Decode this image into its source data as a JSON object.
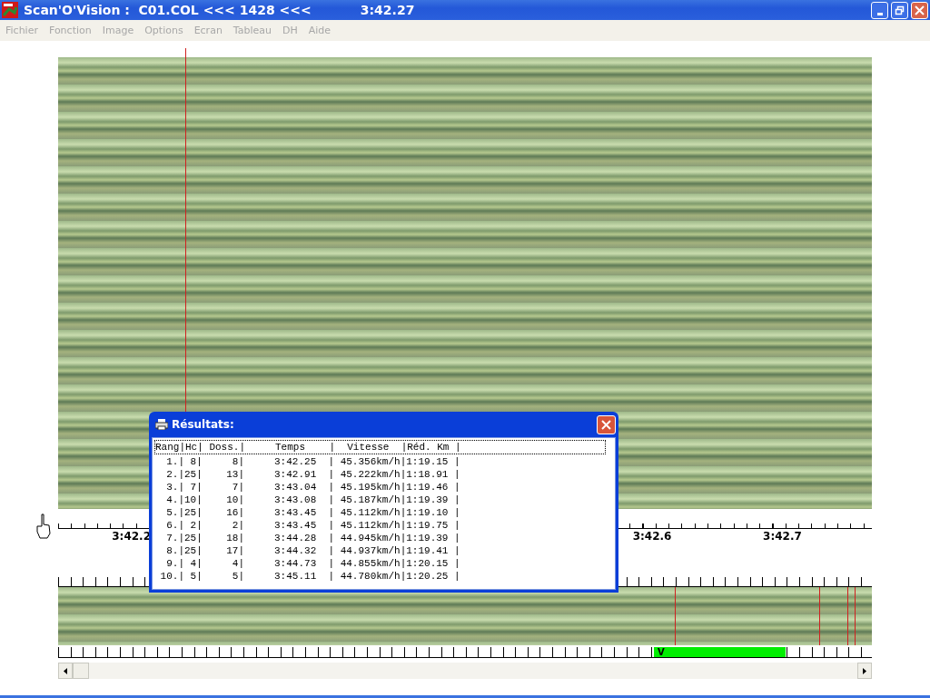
{
  "window": {
    "title": "Scan'O'Vision :  C01.COL <<< 1428 <<<",
    "time": "3:42.27"
  },
  "menu": [
    "Fichier",
    "Fonction",
    "Image",
    "Options",
    "Ecran",
    "Tableau",
    "DH",
    "Aide"
  ],
  "timeline": {
    "labels": [
      "3:42.2",
      "3:42.6",
      "3:42.7"
    ]
  },
  "overview": {
    "window_marker": "V"
  },
  "results": {
    "title": "Résultats:",
    "header": "Rang|Hc| Doss.|     Temps    |  Vitesse  |Réd. Km |",
    "rows": [
      "  1.| 8|     8|     3:42.25  | 45.356km/h|1:19.15 |",
      "  2.|25|    13|     3:42.91  | 45.222km/h|1:18.91 |",
      "  3.| 7|     7|     3:43.04  | 45.195km/h|1:19.46 |",
      "  4.|10|    10|     3:43.08  | 45.187km/h|1:19.39 |",
      "  5.|25|    16|     3:43.45  | 45.112km/h|1:19.10 |",
      "  6.| 2|     2|     3:43.45  | 45.112km/h|1:19.75 |",
      "  7.|25|    18|     3:44.28  | 44.945km/h|1:19.39 |",
      "  8.|25|    17|     3:44.32  | 44.937km/h|1:19.41 |",
      "  9.| 4|     4|     3:44.73  | 44.855km/h|1:20.15 |",
      " 10.| 5|     5|     3:45.11  | 44.780km/h|1:20.25 |"
    ]
  }
}
